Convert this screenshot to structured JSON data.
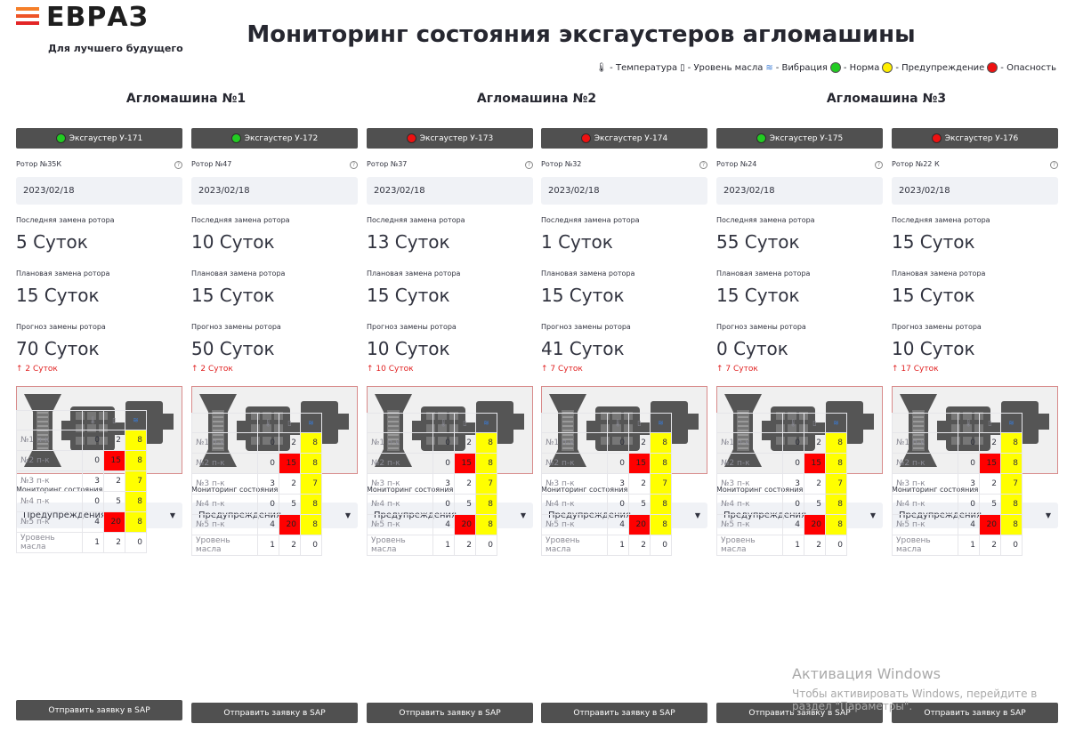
{
  "header": {
    "logo_text": "ЕВРАЗ",
    "logo_tagline": "Для лучшего будущего",
    "title": "Мониторинг состояния эксгаустеров агломашины"
  },
  "legend": {
    "temperature": "- Температура",
    "oil": "- Уровень масла",
    "vibration": "- Вибрация",
    "norm": "- Норма",
    "warning": "- Предупреждение",
    "danger": "- Опасность"
  },
  "machines": [
    "Агломашина №1",
    "Агломашина №2",
    "Агломашина №3"
  ],
  "colors": {
    "ok": "#22cc22",
    "warn": "#ffee00",
    "danger": "#ee1111"
  },
  "labels": {
    "last_change": "Последняя замена ротора",
    "planned_change": "Плановая замена ротора",
    "forecast": "Прогноз замены ротора",
    "monitoring": "Мониторинг состояния",
    "sap_button": "Отправить заявку в SAP",
    "oil_row": "Уровень масла"
  },
  "exhausters": [
    {
      "name": "Эксгаустер У-171",
      "status": "ok",
      "rotor": "Ротор №35К",
      "date": "2023/02/18",
      "last": "5 Суток",
      "planned": "15 Суток",
      "forecast": "70 Суток",
      "delta": "↑ 2 Суток",
      "filter": "Предупреждения"
    },
    {
      "name": "Эксгаустер У-172",
      "status": "ok",
      "rotor": "Ротор №47",
      "date": "2023/02/18",
      "last": "10 Суток",
      "planned": "15 Суток",
      "forecast": "50 Суток",
      "delta": "↑ 2 Суток",
      "filter": "Предупреждения"
    },
    {
      "name": "Эксгаустер У-173",
      "status": "danger",
      "rotor": "Ротор №37",
      "date": "2023/02/18",
      "last": "13 Суток",
      "planned": "15 Суток",
      "forecast": "10 Суток",
      "delta": "↑ 10 Суток",
      "filter": "Предупреждения"
    },
    {
      "name": "Эксгаустер У-174",
      "status": "danger",
      "rotor": "Ротор №32",
      "date": "2023/02/18",
      "last": "1 Суток",
      "planned": "15 Суток",
      "forecast": "41 Суток",
      "delta": "↑ 7 Суток",
      "filter": "Предупреждения"
    },
    {
      "name": "Эксгаустер У-175",
      "status": "ok",
      "rotor": "Ротор №24",
      "date": "2023/02/18",
      "last": "55 Суток",
      "planned": "15 Суток",
      "forecast": "0 Суток",
      "delta": "↑ 7 Суток",
      "filter": "Предупреждения"
    },
    {
      "name": "Эксгаустер У-176",
      "status": "danger",
      "rotor": "Ротор №22 К",
      "date": "2023/02/18",
      "last": "15 Суток",
      "planned": "15 Суток",
      "forecast": "10 Суток",
      "delta": "↑ 17 Суток",
      "filter": "Предупреждения"
    }
  ],
  "table": {
    "rows": [
      {
        "label": "№1 п-к",
        "t": "0",
        "o": "2",
        "v": "8",
        "o_state": "",
        "v_state": "y"
      },
      {
        "label": "№2 п-к",
        "t": "0",
        "o": "15",
        "v": "8",
        "o_state": "r",
        "v_state": "y"
      },
      {
        "label": "№3 п-к",
        "t": "3",
        "o": "2",
        "v": "7",
        "o_state": "",
        "v_state": "y"
      },
      {
        "label": "№4 п-к",
        "t": "0",
        "o": "5",
        "v": "8",
        "o_state": "",
        "v_state": "y"
      },
      {
        "label": "№5 п-к",
        "t": "4",
        "o": "20",
        "v": "8",
        "o_state": "r",
        "v_state": "y"
      },
      {
        "label": "Уровень масла",
        "t": "1",
        "o": "2",
        "v": "0",
        "o_state": "",
        "v_state": ""
      }
    ]
  },
  "watermark": {
    "line1": "Активация Windows",
    "line2": "Чтобы активировать Windows, перейдите в",
    "line3": "раздел \"Параметры\"."
  }
}
